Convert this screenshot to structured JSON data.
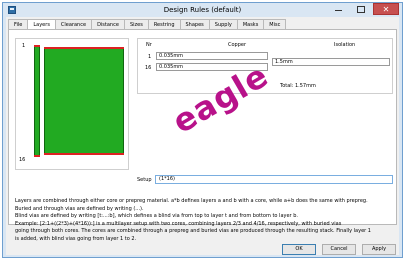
{
  "window": {
    "title": "Design Rules (default)"
  },
  "tabs": [
    "File",
    "Layers",
    "Clearance",
    "Distance",
    "Sizes",
    "Restring",
    "Shapes",
    "Supply",
    "Masks",
    "Misc"
  ],
  "preview": {
    "top_layer": "1",
    "bottom_layer": "16"
  },
  "layers_table": {
    "headers": {
      "nr": "Nr",
      "copper": "Copper",
      "isolation": "Isolation"
    },
    "rows": [
      {
        "nr": "1",
        "copper": "0.035mm"
      },
      {
        "nr": "16",
        "copper": "0.035mm"
      }
    ],
    "isolation_value": "1.5mm",
    "total": "Total:  1.57mm"
  },
  "setup": {
    "label": "Setup",
    "value": "(1*16)"
  },
  "help_lines": [
    "Layers are combined through either core or prepreg material.  a*b defines layers a and b with a core, while a+b does the same with prepreg.",
    "Buried and through vias are defined by writing (...).",
    "Blind vias are defined by writing [t:...:b], which defines a blind via from top to layer t and from bottom to layer b.",
    "Example: [2:1+((2*3)+(4*16)):] is a multilayer setup with two cores, combining layers 2/3 and 4/16, respectively, with buried vias",
    "going through both cores. The cores are combined through a prepreg and buried vias are produced through the resulting stack. Finally layer 1",
    "is added, with blind vias going from layer 1 to 2."
  ],
  "watermark": "eagle",
  "buttons": {
    "ok": "OK",
    "cancel": "Cancel",
    "apply": "Apply"
  },
  "colors": {
    "copper": "#22aa22",
    "copper_edge": "#dd2222",
    "watermark": "#b8128a",
    "accent": "#3c7fb1"
  }
}
